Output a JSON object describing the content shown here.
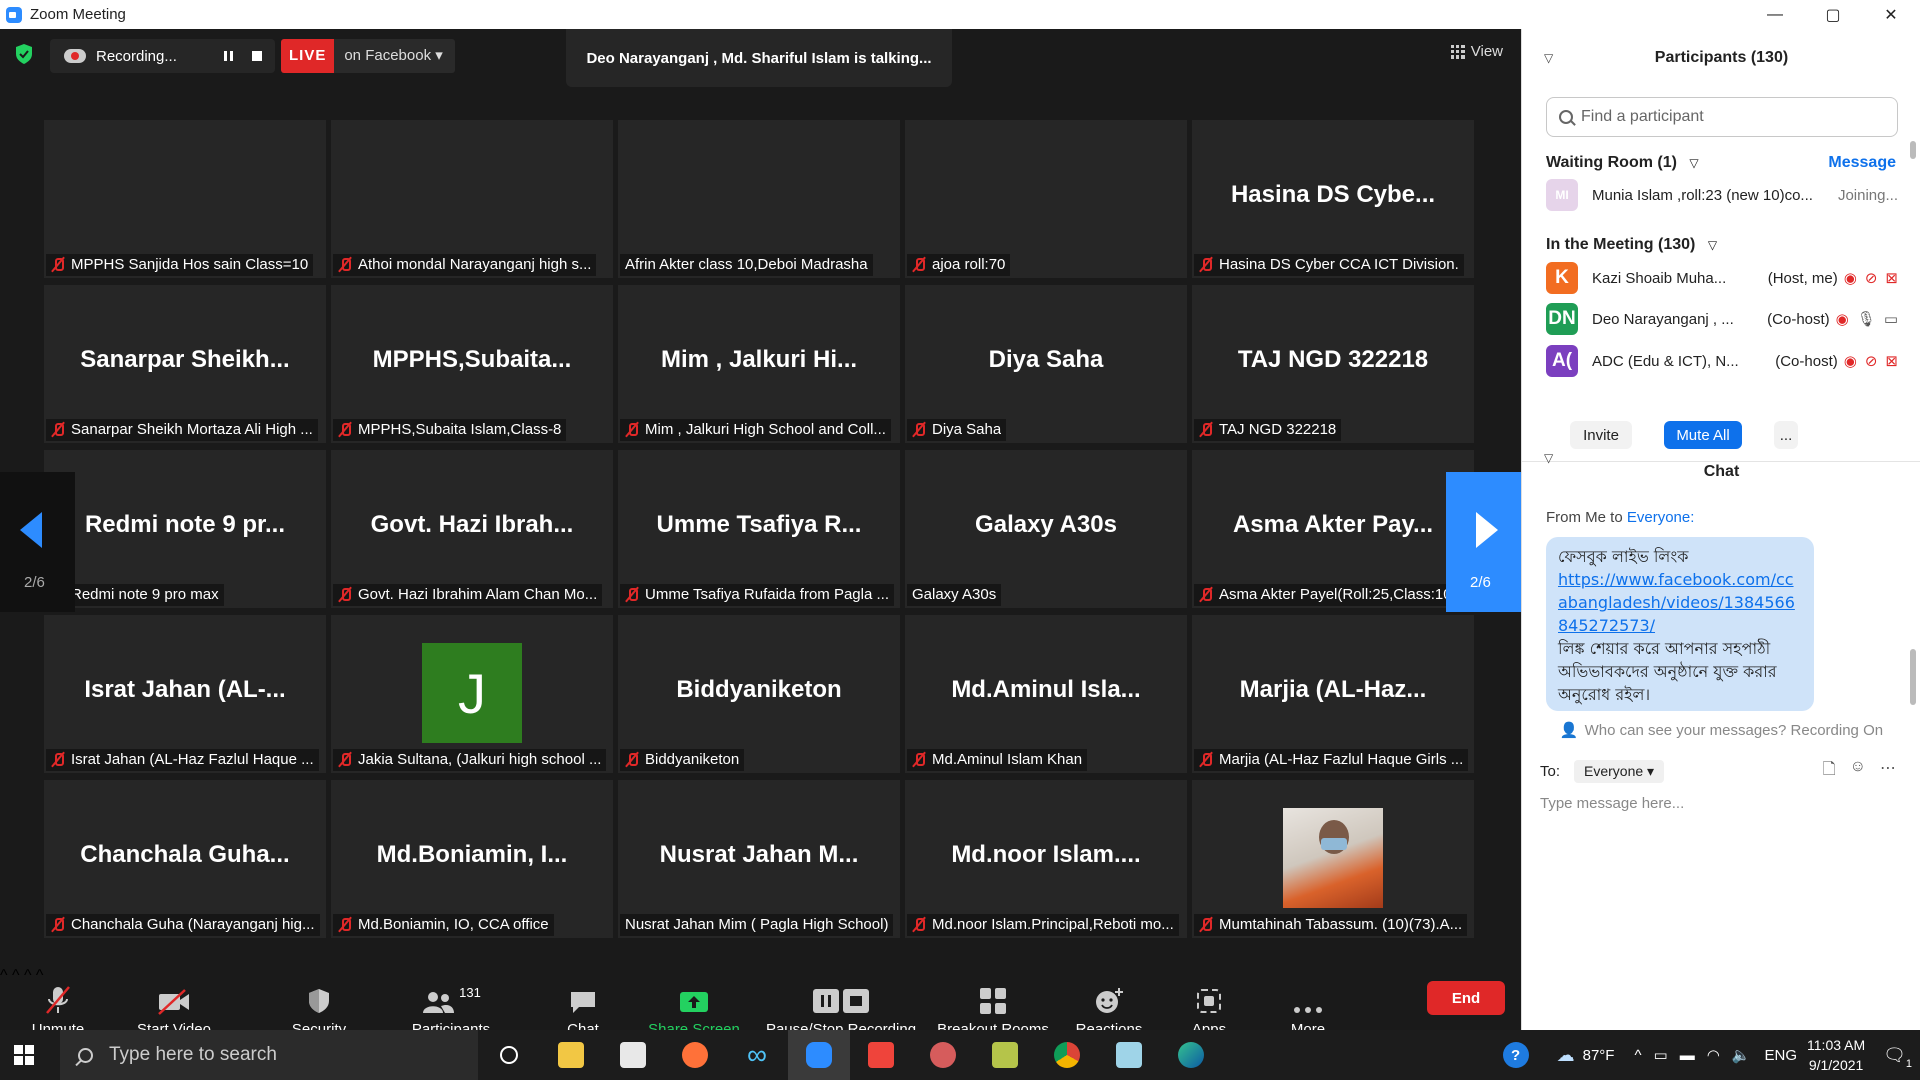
{
  "window": {
    "title": "Zoom Meeting",
    "controls": [
      "—",
      "▢",
      "✕"
    ]
  },
  "topbar": {
    "recording_label": "Recording...",
    "live_label": "LIVE",
    "live_target": "on Facebook",
    "talking": "Deo Narayanganj , Md. Shariful Islam is talking...",
    "view_label": "View"
  },
  "tiles": [
    {
      "big": "",
      "label": "MPPHS Sanjida Hos sain Class=10",
      "muted": true
    },
    {
      "big": "",
      "label": "Athoi mondal Narayanganj high s...",
      "muted": true
    },
    {
      "big": "",
      "label": "Afrin Akter  class 10,Deboi Madrasha",
      "muted": false
    },
    {
      "big": "",
      "label": "ajoa roll:70",
      "muted": true
    },
    {
      "big": "Hasina DS Cybe...",
      "label": "Hasina DS Cyber CCA ICT Division.",
      "muted": true
    },
    {
      "big": "Sanarpar Sheikh...",
      "label": "Sanarpar Sheikh Mortaza Ali High ...",
      "muted": true
    },
    {
      "big": "MPPHS,Subaita...",
      "label": "MPPHS,Subaita Islam,Class-8",
      "muted": true
    },
    {
      "big": "Mim , Jalkuri Hi...",
      "label": "Mim , Jalkuri High School and Coll...",
      "muted": true
    },
    {
      "big": "Diya Saha",
      "label": "Diya Saha",
      "muted": true
    },
    {
      "big": "TAJ NGD 322218",
      "label": "TAJ NGD 322218",
      "muted": true
    },
    {
      "big": "Redmi note 9 pr...",
      "label": "Redmi note 9 pro max",
      "muted": true
    },
    {
      "big": "Govt. Hazi Ibrah...",
      "label": "Govt. Hazi Ibrahim Alam Chan Mo...",
      "muted": true
    },
    {
      "big": "Umme Tsafiya R...",
      "label": "Umme Tsafiya Rufaida from Pagla ...",
      "muted": true
    },
    {
      "big": "Galaxy A30s",
      "label": "Galaxy A30s",
      "muted": false
    },
    {
      "big": "Asma Akter Pay...",
      "label": "Asma Akter Payel(Roll:25,Class:10-...",
      "muted": true
    },
    {
      "big": "Israt Jahan (AL-...",
      "label": "Israt Jahan (AL-Haz Fazlul Haque ...",
      "muted": true
    },
    {
      "big": "",
      "avatar": "J",
      "label": "Jakia Sultana, (Jalkuri high school ...",
      "muted": true
    },
    {
      "big": "Biddyaniketon",
      "label": "Biddyaniketon",
      "muted": true
    },
    {
      "big": "Md.Aminul Isla...",
      "label": "Md.Aminul Islam Khan",
      "muted": true
    },
    {
      "big": "Marjia (AL-Haz...",
      "label": "Marjia (AL-Haz Fazlul Haque Girls ...",
      "muted": true
    },
    {
      "big": "Chanchala Guha...",
      "label": "Chanchala Guha (Narayanganj hig...",
      "muted": true
    },
    {
      "big": "Md.Boniamin, I...",
      "label": "Md.Boniamin, IO, CCA office",
      "muted": true
    },
    {
      "big": "Nusrat Jahan M...",
      "label": "Nusrat Jahan Mim ( Pagla High School)",
      "muted": false
    },
    {
      "big": "Md.noor Islam....",
      "label": "Md.noor Islam.Principal,Reboti mo...",
      "muted": true
    },
    {
      "big": "",
      "photo": true,
      "label": "Mumtahinah Tabassum. (10)(73).A...",
      "muted": true
    }
  ],
  "pager": {
    "left": "2/6",
    "right": "2/6"
  },
  "toolbar": {
    "unmute": "Unmute",
    "start_video": "Start Video",
    "security": "Security",
    "participants": "Participants",
    "participants_count": "131",
    "chat": "Chat",
    "share_screen": "Share Screen",
    "pause_stop": "Pause/Stop Recording",
    "breakout": "Breakout Rooms",
    "reactions": "Reactions",
    "apps": "Apps",
    "more": "More",
    "end": "End"
  },
  "participants_panel": {
    "title": "Participants (130)",
    "search_placeholder": "Find a participant",
    "waiting_room": "Waiting Room (1)",
    "message": "Message",
    "waiting": {
      "initials": "MI",
      "name": "Munia Islam ,roll:23 (new 10)co...",
      "status": "Joining..."
    },
    "in_meeting": "In the Meeting (130)",
    "people": [
      {
        "initials": "K",
        "color": "#f26d21",
        "name": "Kazi Shoaib Muha...",
        "tag": "(Host, me)"
      },
      {
        "initials": "DN",
        "color": "#1f9d55",
        "name": "Deo Narayanganj , ...",
        "tag": "(Co-host)"
      },
      {
        "initials": "A(",
        "color": "#7b3fbf",
        "name": "ADC (Edu & ICT), N...",
        "tag": "(Co-host)"
      }
    ],
    "invite": "Invite",
    "mute_all": "Mute All",
    "more": "..."
  },
  "chat_panel": {
    "title": "Chat",
    "from_prefix": "From Me to ",
    "from_target": "Everyone:",
    "message_line1": "ফেসবুক লাইভ লিংক",
    "message_link": "https://www.facebook.com/ccabangladesh/videos/1384566845272573/",
    "message_line2": "লিঙ্ক শেয়ার করে আপনার সহপাঠী অভিভাবকদের অনুষ্ঠানে যুক্ত করার অনুরোধ রইল।",
    "who_can_see": "Who can see your messages? Recording On",
    "to_label": "To:",
    "to_value": "Everyone",
    "input_placeholder": "Type message here..."
  },
  "taskbar": {
    "search_placeholder": "Type here to search",
    "temperature": "87°F",
    "language": "ENG",
    "time": "11:03 AM",
    "date": "9/1/2021",
    "notification_count": "1"
  }
}
